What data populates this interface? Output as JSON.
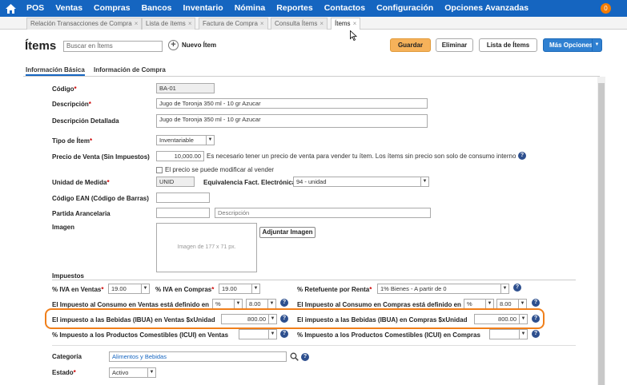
{
  "app": {
    "menu": [
      "POS",
      "Ventas",
      "Compras",
      "Bancos",
      "Inventario",
      "Nómina",
      "Reportes",
      "Contactos",
      "Configuración",
      "Opciones Avanzadas"
    ],
    "notifications": "0"
  },
  "tabs": [
    {
      "label": "Relación Transacciones de Compra"
    },
    {
      "label": "Lista de ítems"
    },
    {
      "label": "Factura de Compra"
    },
    {
      "label": "Consulta Ítems"
    },
    {
      "label": "Ítems"
    }
  ],
  "header": {
    "title": "Ítems",
    "search_placeholder": "Buscar en Ítems",
    "new_item": "Nuevo Ítem",
    "save": "Guardar",
    "delete": "Eliminar",
    "list": "Lista de Ítems",
    "more": "Más Opciones"
  },
  "subtabs": [
    "Información Básica",
    "Información de Compra"
  ],
  "form": {
    "codigo": {
      "label": "Código",
      "value": "BA-01"
    },
    "descripcion": {
      "label": "Descripción",
      "value": "Jugo de Toronja 350 ml - 10 gr Azucar"
    },
    "descripcion_det": {
      "label": "Descripción Detallada",
      "value": "Jugo de Toronja 350 ml - 10 gr Azucar"
    },
    "tipo": {
      "label": "Tipo de Ítem",
      "value": "Inventariable"
    },
    "precio": {
      "label": "Precio de Venta (Sin Impuestos)",
      "value": "10,000.00",
      "note": "Es necesario tener un precio de venta para vender tu ítem. Los ítems sin precio son solo de consumo interno"
    },
    "modificable": "El precio se puede modificar al vender",
    "unidad": {
      "label": "Unidad de Medida",
      "value": "UNID"
    },
    "equivalencia": {
      "label": "Equivalencia Fact. Electrónica",
      "value": "94 - unidad"
    },
    "ean": {
      "label": "Código EAN (Código de Barras)",
      "value": ""
    },
    "partida": {
      "label": "Partida Arancelaria",
      "value": "",
      "desc_placeholder": "Descripción"
    },
    "imagen": {
      "label": "Imagen",
      "placeholder": "Imagen de 177 x 71 px.",
      "attach": "Adjuntar Imagen"
    }
  },
  "impuestos": {
    "heading": "Impuestos",
    "iva_ventas": {
      "label": "% IVA en Ventas",
      "value": "19.00"
    },
    "iva_compras": {
      "label": "% IVA en Compras",
      "value": "19.00"
    },
    "retefuente": {
      "label": "% Retefuente por Renta",
      "value": "1% Bienes - A partir de 0"
    },
    "consumo_ventas": {
      "label": "El Impuesto al Consumo en Ventas está definido en",
      "unit": "%",
      "value": "8.00"
    },
    "consumo_compras": {
      "label": "El Impuesto al Consumo en Compras está definido en",
      "unit": "%",
      "value": "8.00"
    },
    "ibua_ventas": {
      "label": "El impuesto a las Bebidas (IBUA) en Ventas $xUnidad",
      "value": "800.00"
    },
    "ibua_compras": {
      "label": "El impuesto a las Bebidas (IBUA) en Compras $xUnidad",
      "value": "800.00"
    },
    "icui_ventas": {
      "label": "% Impuesto a los Productos Comestibles (ICUI) en Ventas",
      "value": ""
    },
    "icui_compras": {
      "label": "% Impuesto a los Productos Comestibles (ICUI) en Compras",
      "value": ""
    }
  },
  "categoria": {
    "label": "Categoría",
    "value": "Alimentos y Bebidas"
  },
  "estado": {
    "label": "Estado",
    "value": "Activo"
  },
  "colors": {
    "primary": "#1565c0",
    "accent": "#f07f1a",
    "save": "#f6b25a"
  }
}
